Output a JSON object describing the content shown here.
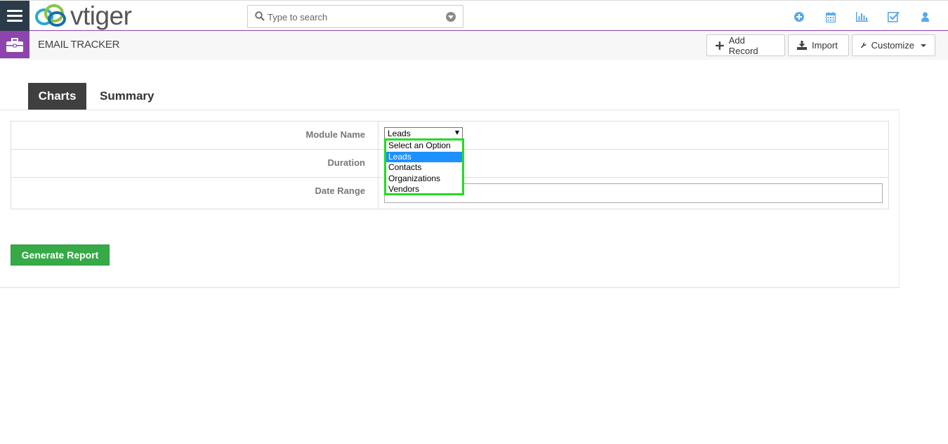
{
  "app": {
    "logo_text": "vtiger"
  },
  "search": {
    "placeholder": "Type to search"
  },
  "top_icons": [
    "plus-circle-icon",
    "calendar-icon",
    "bar-chart-icon",
    "checkbox-icon",
    "user-icon"
  ],
  "module": {
    "title": "EMAIL TRACKER",
    "add_record_label": "Add Record",
    "import_label": "Import",
    "customize_label": "Customize"
  },
  "tabs": [
    {
      "label": "Charts",
      "active": true
    },
    {
      "label": "Summary",
      "active": false
    }
  ],
  "form": {
    "module_name_label": "Module Name",
    "duration_label": "Duration",
    "date_range_label": "Date Range",
    "module_value": "Leads",
    "date_range_value": ""
  },
  "dropdown": {
    "options": [
      "Select an Option",
      "Leads",
      "Contacts",
      "Organizations",
      "Vendors"
    ],
    "selected": "Leads",
    "highlight_color": "#22dd22"
  },
  "generate_label": "Generate Report",
  "colors": {
    "accent": "#8e44ad",
    "nav_dark": "#2c3b49",
    "primary_green": "#35aa47",
    "tab_active": "#3f3f3f",
    "option_selected": "#1e90ff"
  }
}
